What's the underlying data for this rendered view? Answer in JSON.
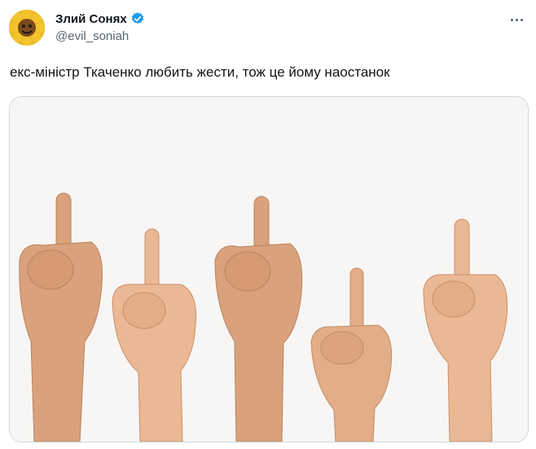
{
  "tweet": {
    "author_name": "Злий Сонях",
    "handle": "@evil_soniah",
    "text": "екс-міністр Ткаченко любить жести, тож це йому наостанок",
    "verified_color": "#1d9bf0"
  },
  "icons": {
    "avatar": "sunflower-avatar-icon",
    "verified": "verified-badge-icon",
    "more": "more-options-icon"
  },
  "media": {
    "image": "five-raised-middle-finger-hands-photo"
  }
}
